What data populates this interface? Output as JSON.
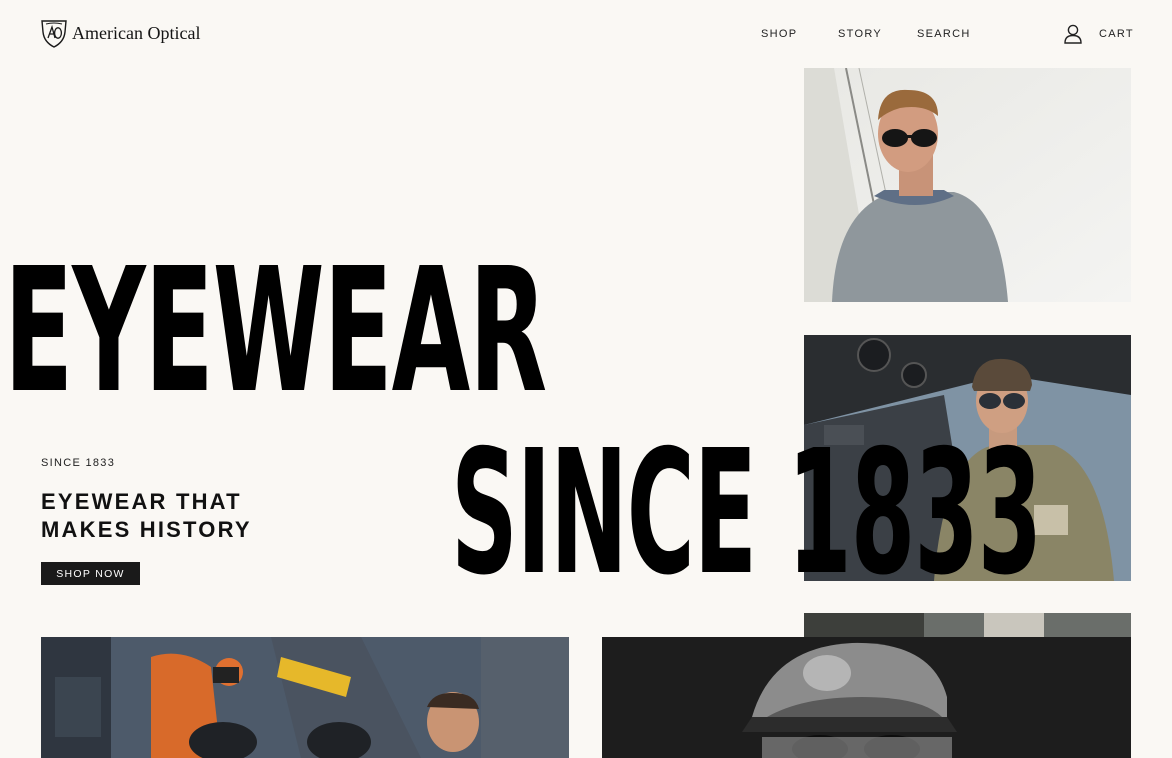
{
  "header": {
    "brand": "American Optical",
    "logo_icon": "ao-shield-icon",
    "nav": {
      "shop": "SHOP",
      "story": "STORY",
      "search": "SEARCH",
      "account_icon": "user-icon",
      "cart": "CART"
    }
  },
  "hero": {
    "headline_line1": "EYEWEAR",
    "headline_line2": "SINCE 1833",
    "eyebrow": "SINCE 1833",
    "tagline_line1": "EYEWEAR THAT",
    "tagline_line2": "MAKES HISTORY",
    "cta_label": "SHOP NOW"
  },
  "colors": {
    "background": "#faf8f4",
    "text": "#000000",
    "button": "#1a1a1a"
  }
}
